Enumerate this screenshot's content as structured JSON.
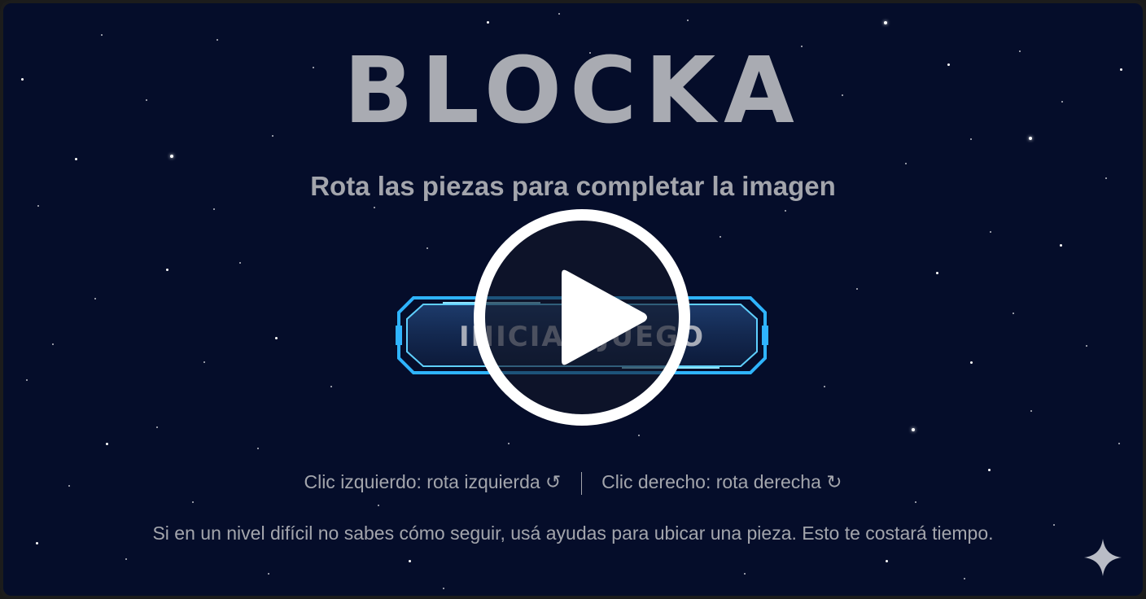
{
  "game": {
    "title": "BLOCKA",
    "subtitle": "Rota las piezas para completar la imagen",
    "start_label": "INICIAR JUEGO"
  },
  "instructions": {
    "left_click": "Clic izquierdo: rota izquierda ↺",
    "right_click": "Clic derecho: rota derecha ↻",
    "hint": "Si en un nivel difícil no sabes cómo seguir, usá ayudas para ubicar una pieza. Esto te costará tiempo."
  },
  "video": {
    "play_icon": "play-icon",
    "watermark_icon": "sparkle-icon"
  },
  "colors": {
    "background": "#050d2a",
    "title": "#a9abb2",
    "button_glow": "#2fb4ff"
  }
}
